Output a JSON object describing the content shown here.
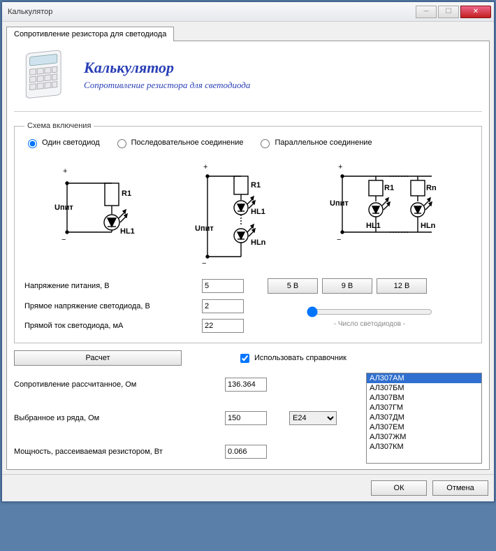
{
  "window": {
    "title": "Калькулятор"
  },
  "tab": {
    "label": "Сопротивление резистора для светодиода"
  },
  "header": {
    "title": "Калькулятор",
    "subtitle": "Сопротивление резистора для светодиода"
  },
  "scheme": {
    "legend": "Схема включения",
    "opt_single": "Один светодиод",
    "opt_series": "Последовательное соединение",
    "opt_parallel": "Параллельное соединение",
    "selected": "single"
  },
  "inputs": {
    "supply_label": "Напряжение питания, В",
    "supply_value": "5",
    "vf_label": "Прямое напряжение светодиода, В",
    "vf_value": "2",
    "if_label": "Прямой ток светодиода, мА",
    "if_value": "22",
    "preset_5v": "5 В",
    "preset_9v": "9 В",
    "preset_12v": "12 В",
    "led_count_label": "- Число светодиодов -"
  },
  "calc": {
    "button": "Расчет"
  },
  "ref": {
    "use_checkbox": "Использовать справочник",
    "checked": true,
    "items": [
      "АЛ307АМ",
      "АЛ307БМ",
      "АЛ307ВМ",
      "АЛ307ГМ",
      "АЛ307ДМ",
      "АЛ307ЕМ",
      "АЛ307ЖМ",
      "АЛ307КМ"
    ],
    "selected_index": 0
  },
  "results": {
    "r_calc_label": "Сопротивление рассчитанное, Ом",
    "r_calc_value": "136.364",
    "r_series_label": "Выбранное из ряда, Ом",
    "r_series_value": "150",
    "series_sel": "E24",
    "power_label": "Мощность, рассеиваемая резистором, Вт",
    "power_value": "0.066"
  },
  "footer": {
    "ok": "ОК",
    "cancel": "Отмена"
  },
  "diagram_labels": {
    "upit": "Uпит",
    "r1": "R1",
    "rn": "Rn",
    "hl1": "HL1",
    "hln": "HLn"
  }
}
